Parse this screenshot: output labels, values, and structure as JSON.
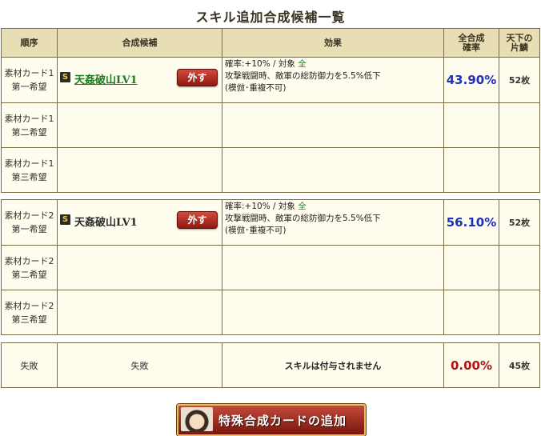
{
  "page_title": "スキル追加合成候補一覧",
  "headers": {
    "order": "順序",
    "candidate": "合成候補",
    "effect": "効果",
    "rate_line1": "全合成",
    "rate_line2": "確率",
    "fragments_line1": "天下の",
    "fragments_line2": "片鱗"
  },
  "material1": {
    "rows": [
      {
        "order_line1": "素材カード1",
        "order_line2": "第一希望"
      },
      {
        "order_line1": "素材カード1",
        "order_line2": "第二希望"
      },
      {
        "order_line1": "素材カード1",
        "order_line2": "第三希望"
      }
    ],
    "badge": "S",
    "skill_name": "天姦破山LV1",
    "remove_label": "外す",
    "effect_line1_prefix": "確率:+10% / 対象 ",
    "effect_target": "全",
    "effect_line2": "攻撃戦闘時、敵軍の総防御力を5.5%低下",
    "effect_line3": "(模倣･重複不可)",
    "rate": "43.90%",
    "count": "52枚"
  },
  "material2": {
    "rows": [
      {
        "order_line1": "素材カード2",
        "order_line2": "第一希望"
      },
      {
        "order_line1": "素材カード2",
        "order_line2": "第二希望"
      },
      {
        "order_line1": "素材カード2",
        "order_line2": "第三希望"
      }
    ],
    "badge": "S",
    "skill_name": "天姦破山LV1",
    "remove_label": "外す",
    "effect_line1_prefix": "確率:+10% / 対象 ",
    "effect_target": "全",
    "effect_line2": "攻撃戦闘時、敵軍の総防御力を5.5%低下",
    "effect_line3": "(模倣･重複不可)",
    "rate": "56.10%",
    "count": "52枚"
  },
  "failure": {
    "order": "失敗",
    "candidate": "失敗",
    "effect": "スキルは付与されません",
    "rate": "0.00%",
    "count": "45枚"
  },
  "add_card_button": "特殊合成カードの追加",
  "colors": {
    "header_bg": "#e8deb6",
    "row_bg": "#fffdee",
    "border": "#7a6d45",
    "rate_blue": "#1f2fb8",
    "rate_red": "#b31212",
    "skill_link": "#1d7a1d",
    "target_green": "#2a8a2a",
    "button_red": "#a0261a"
  },
  "icons": {
    "rank_badge": "s-rank-icon",
    "portrait": "general-portrait-icon"
  }
}
